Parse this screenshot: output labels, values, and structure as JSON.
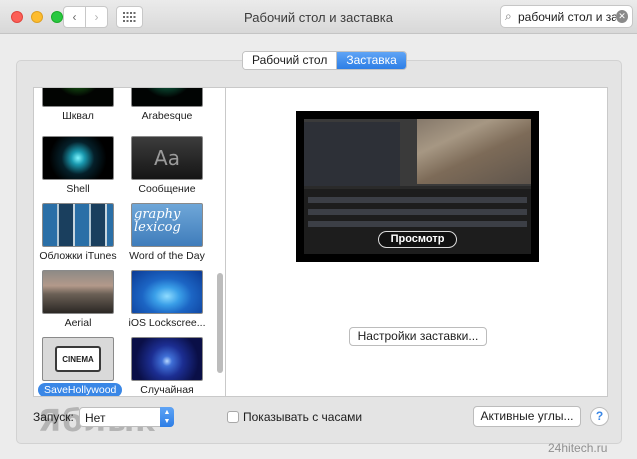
{
  "window": {
    "title": "Рабочий стол и заставка",
    "search_value": "рабочий стол и заст"
  },
  "tabs": [
    {
      "label": "Рабочий стол",
      "active": false
    },
    {
      "label": "Заставка",
      "active": true
    }
  ],
  "screensavers": [
    {
      "label": "Шквал",
      "thumb": "shkval"
    },
    {
      "label": "Arabesque",
      "thumb": "arabesque"
    },
    {
      "label": "Shell",
      "thumb": "shell"
    },
    {
      "label": "Сообщение",
      "thumb": "message",
      "thumb_text": "Aa"
    },
    {
      "label": "Обложки iTunes",
      "thumb": "itunes"
    },
    {
      "label": "Word of the Day",
      "thumb": "word",
      "thumb_text": "graphy lexicog"
    },
    {
      "label": "Aerial",
      "thumb": "aerial"
    },
    {
      "label": "iOS Lockscree...",
      "thumb": "ios"
    },
    {
      "label": "SaveHollywood",
      "thumb": "hollywood",
      "thumb_text": "CINEMA",
      "selected": true
    },
    {
      "label": "Случайная",
      "thumb": "random"
    }
  ],
  "preview": {
    "button_label": "Просмотр"
  },
  "settings_button": "Настройки заставки...",
  "bottom": {
    "start_label": "Запуск:",
    "start_value": "Нет",
    "show_clock_label": "Показывать с часами",
    "show_clock_checked": false,
    "hot_corners_label": "Активные углы...",
    "help_label": "?"
  },
  "watermarks": {
    "left": "Яблык",
    "right": "24hitech.ru"
  },
  "colors": {
    "accent": "#2d7ee6",
    "close": "#fc5f57",
    "minimize": "#fdbc2e",
    "maximize": "#28c840"
  }
}
